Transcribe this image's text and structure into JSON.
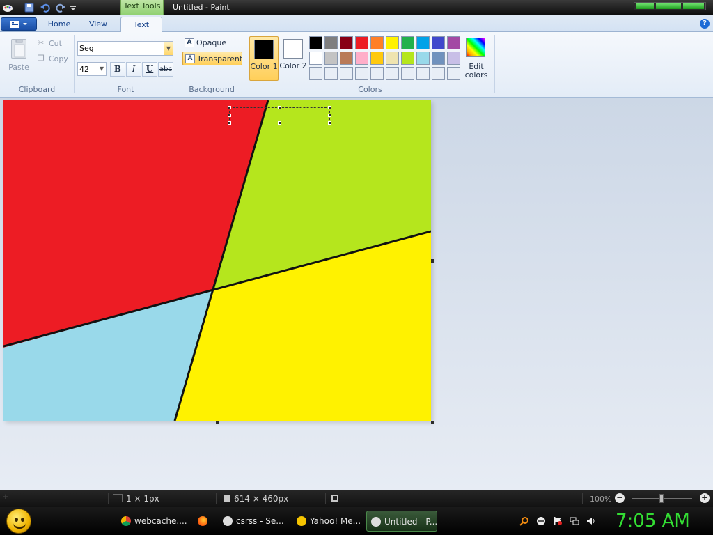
{
  "window": {
    "context_tab": "Text Tools",
    "title": "Untitled - Paint"
  },
  "tabs": {
    "home": "Home",
    "view": "View",
    "text": "Text",
    "active": "Text"
  },
  "clipboard": {
    "paste": "Paste",
    "cut": "Cut",
    "copy": "Copy",
    "group_label": "Clipboard"
  },
  "font": {
    "family_value": "Seg",
    "size_value": "42",
    "bold": "B",
    "italic": "I",
    "underline": "U",
    "strikethrough": "abc",
    "group_label": "Font"
  },
  "background": {
    "opaque": "Opaque",
    "transparent": "Transparent",
    "selected": "Transparent",
    "group_label": "Background"
  },
  "colors": {
    "color1_label": "Color 1",
    "color2_label": "Color 2",
    "color1_value": "#000000",
    "color2_value": "#ffffff",
    "edit_label": "Edit colors",
    "group_label": "Colors",
    "palette_row1": [
      "#000000",
      "#7f7f7f",
      "#880015",
      "#ed1c24",
      "#ff7f27",
      "#fff200",
      "#22b14c",
      "#00a2e8",
      "#3f48cc",
      "#a349a4"
    ],
    "palette_row2": [
      "#ffffff",
      "#c3c3c3",
      "#b97a57",
      "#ffaec9",
      "#ffc90e",
      "#efe4b0",
      "#b5e61d",
      "#99d9ea",
      "#7092be",
      "#c8bfe7"
    ],
    "palette_row3": [
      "#e8eef6",
      "#e8eef6",
      "#e8eef6",
      "#e8eef6",
      "#e8eef6",
      "#e8eef6",
      "#e8eef6",
      "#e8eef6",
      "#e8eef6",
      "#e8eef6"
    ]
  },
  "canvas": {
    "regions": {
      "red": "#ed1c24",
      "green": "#b5e61d",
      "yellow": "#fff200",
      "light_blue": "#99d9ea"
    }
  },
  "status": {
    "selection": "1 × 1px",
    "image_size": "614 × 460px",
    "zoom": "100%"
  },
  "taskbar": {
    "tasks": [
      "webcache....",
      "csrss - Se...",
      "Yahoo! Me...",
      "Untitled - P..."
    ],
    "clock": "7:05 AM"
  }
}
